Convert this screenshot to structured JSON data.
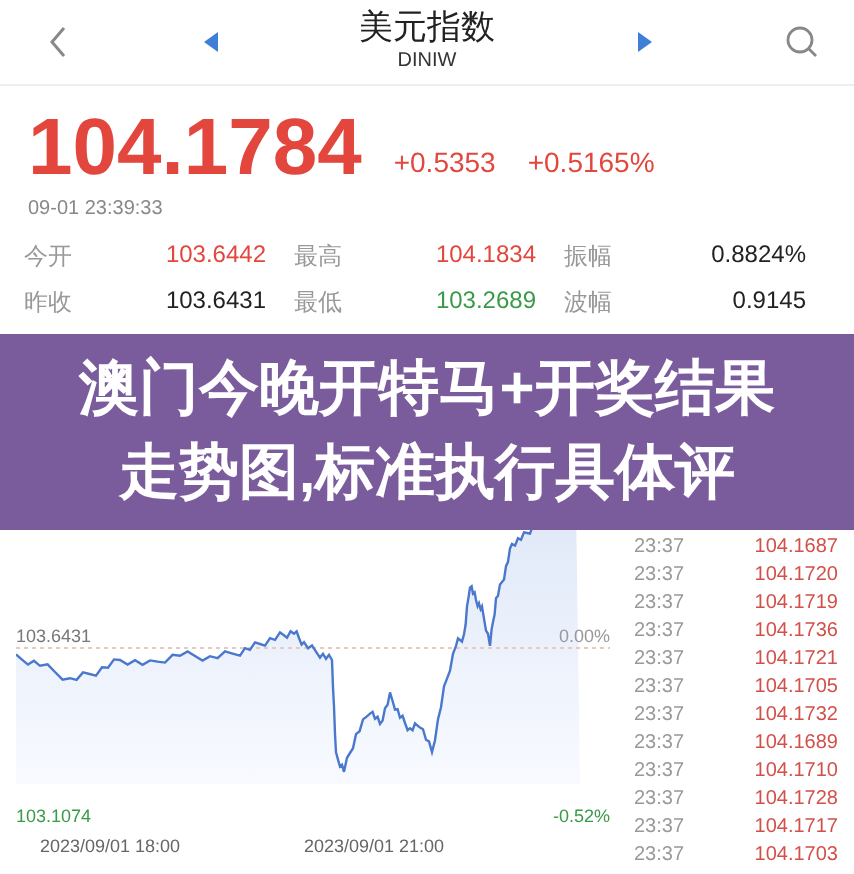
{
  "header": {
    "title": "美元指数",
    "subtitle": "DINIW"
  },
  "quote": {
    "price": "104.1784",
    "change": "+0.5353",
    "change_pct": "+0.5165%",
    "time": "09-01 23:39:33"
  },
  "stats": [
    {
      "label": "今开",
      "value": "103.6442",
      "color": "#e2463c"
    },
    {
      "label": "最高",
      "value": "104.1834",
      "color": "#e2463c"
    },
    {
      "label": "振幅",
      "value": "0.8824%",
      "color": "#222222"
    },
    {
      "label": "昨收",
      "value": "103.6431",
      "color": "#222222"
    },
    {
      "label": "最低",
      "value": "103.2689",
      "color": "#3a9a48"
    },
    {
      "label": "波幅",
      "value": "0.9145",
      "color": "#222222"
    }
  ],
  "banner": {
    "text": "澳门今晚开特马+开奖结果走势图,标准执行具体评"
  },
  "chart": {
    "base_price": "103.6431",
    "base_pct": "0.00%",
    "low_price": "103.1074",
    "low_pct": "-0.52%",
    "dates": [
      "2023/09/01 18:00",
      "2023/09/01 21:00"
    ]
  },
  "trades": [
    {
      "time": "23:37",
      "price": "104.1687"
    },
    {
      "time": "23:37",
      "price": "104.1720"
    },
    {
      "time": "23:37",
      "price": "104.1719"
    },
    {
      "time": "23:37",
      "price": "104.1736"
    },
    {
      "time": "23:37",
      "price": "104.1721"
    },
    {
      "time": "23:37",
      "price": "104.1705"
    },
    {
      "time": "23:37",
      "price": "104.1732"
    },
    {
      "time": "23:37",
      "price": "104.1689"
    },
    {
      "time": "23:37",
      "price": "104.1710"
    },
    {
      "time": "23:37",
      "price": "104.1728"
    },
    {
      "time": "23:37",
      "price": "104.1717"
    },
    {
      "time": "23:37",
      "price": "104.1703"
    }
  ]
}
